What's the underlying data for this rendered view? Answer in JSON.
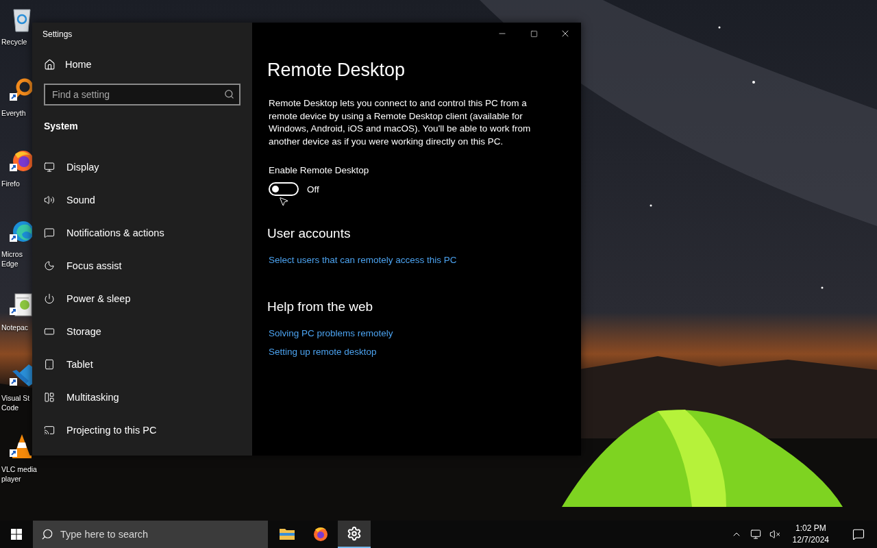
{
  "desktop_icons": [
    {
      "kind": "recycle-bin",
      "lines": [
        "Recycle"
      ]
    },
    {
      "kind": "magnifier",
      "lines": [
        "Everyth"
      ]
    },
    {
      "kind": "fox-browser",
      "lines": [
        "Firefo"
      ]
    },
    {
      "kind": "wave-browser",
      "lines": [
        "Micros",
        "Edge"
      ]
    },
    {
      "kind": "notepad",
      "lines": [
        "Notepac"
      ]
    },
    {
      "kind": "code-editor",
      "lines": [
        "Visual St",
        "Code"
      ]
    },
    {
      "kind": "traffic-cone",
      "lines": [
        "VLC media",
        "player"
      ]
    }
  ],
  "window": {
    "title": "Settings",
    "sidebar": {
      "home": "Home",
      "search": {
        "placeholder": "Find a setting"
      },
      "section": "System",
      "items": [
        {
          "kind": "display",
          "label": "Display",
          "selected": false
        },
        {
          "kind": "sound",
          "label": "Sound",
          "selected": false
        },
        {
          "kind": "notifications",
          "label": "Notifications & actions",
          "selected": false
        },
        {
          "kind": "focus",
          "label": "Focus assist",
          "selected": false
        },
        {
          "kind": "power",
          "label": "Power & sleep",
          "selected": false
        },
        {
          "kind": "storage",
          "label": "Storage",
          "selected": false
        },
        {
          "kind": "tablet",
          "label": "Tablet",
          "selected": false
        },
        {
          "kind": "multitasking",
          "label": "Multitasking",
          "selected": false
        },
        {
          "kind": "projecting",
          "label": "Projecting to this PC",
          "selected": false
        }
      ]
    },
    "content": {
      "title": "Remote Desktop",
      "description": "Remote Desktop lets you connect to and control this PC from a remote device by using a Remote Desktop client (available for Windows, Android, iOS and macOS). You'll be able to work from another device as if you were working directly on this PC.",
      "toggle": {
        "label": "Enable Remote Desktop",
        "on": false,
        "state_text": "Off"
      },
      "sections": [
        {
          "heading": "User accounts",
          "links": [
            "Select users that can remotely access this PC"
          ]
        },
        {
          "heading": "Help from the web",
          "links": [
            "Solving PC problems remotely",
            "Setting up remote desktop"
          ]
        }
      ]
    }
  },
  "taskbar": {
    "search": {
      "placeholder": "Type here to search"
    },
    "apps": [
      {
        "kind": "folder",
        "selected": false
      },
      {
        "kind": "browser",
        "selected": false
      },
      {
        "kind": "settings",
        "selected": true
      }
    ],
    "time": "1:02 PM",
    "date": "12/7/2024"
  }
}
